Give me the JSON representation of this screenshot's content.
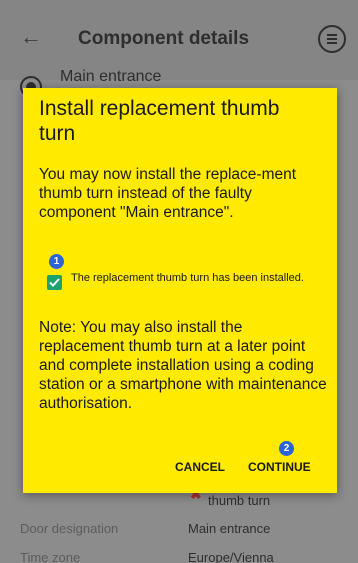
{
  "appbar": {
    "title": "Component details"
  },
  "component": {
    "name": "Main entrance"
  },
  "details": [
    {
      "label": "Door designation",
      "value": "Main entrance"
    },
    {
      "label": "Time zone",
      "value": "Europe/Vienna"
    }
  ],
  "behind_dialog": {
    "thumb_label": "thumb turn"
  },
  "dialog": {
    "title": "Install replacement thumb turn",
    "body": "You may now install the replace-ment thumb turn instead of the faulty component \"Main entrance\".",
    "badge1": "1",
    "checkbox_label": "The replacement thumb turn has been installed.",
    "checkbox_checked": true,
    "note": "Note: You may also install the replacement thumb turn at a later point and complete installation using a coding station or a smartphone with maintenance authorisation.",
    "badge2": "2",
    "cancel_label": "CANCEL",
    "continue_label": "CONTINUE"
  },
  "colors": {
    "dialog_bg": "#ffea00",
    "checkbox": "#1aa36d",
    "badge": "#2c63d6"
  }
}
